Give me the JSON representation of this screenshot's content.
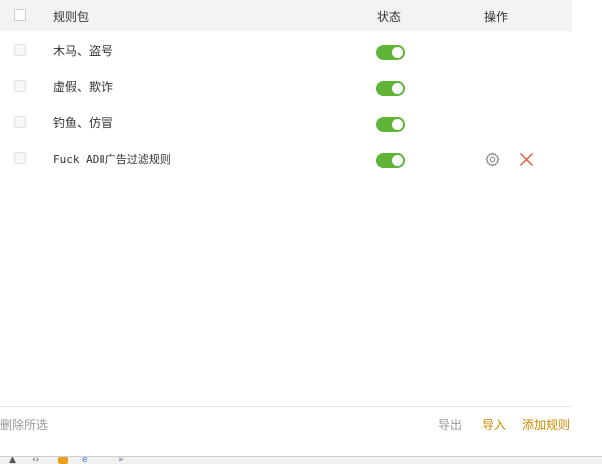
{
  "header": {
    "col_package": "规则包",
    "col_status": "状态",
    "col_actions": "操作"
  },
  "rows": [
    {
      "name": "木马、盗号",
      "enabled": true,
      "has_actions": false
    },
    {
      "name": "虚假、欺诈",
      "enabled": true,
      "has_actions": false
    },
    {
      "name": "钓鱼、仿冒",
      "enabled": true,
      "has_actions": false
    },
    {
      "name": "Fuck ADⅡ广告过滤规则",
      "enabled": true,
      "has_actions": true
    }
  ],
  "footer": {
    "delete_selected": "删除所选",
    "export": "导出",
    "import": "导入",
    "add_rule": "添加规则"
  },
  "colors": {
    "toggle_on": "#5fb336",
    "link_accent": "#d08a00",
    "delete_icon": "#e05a3a"
  },
  "icons": {
    "settings": "gear-icon",
    "remove": "close-icon"
  }
}
